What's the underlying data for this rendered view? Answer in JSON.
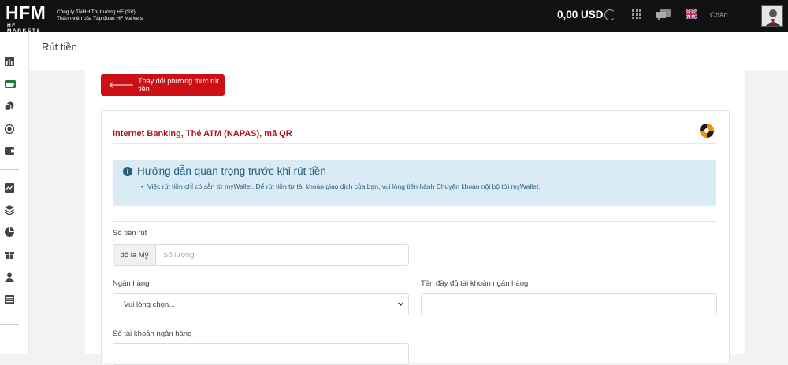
{
  "brand": {
    "logo_text": "HFM",
    "logo_subtext": "HF MARKETS",
    "company_line1": "Công ty TNHH Thị trường HF (SV)",
    "company_line2": "Thành viên của Tập đoàn HF Markets"
  },
  "header": {
    "balance": "0,00 USD",
    "greeting": "Chào"
  },
  "page": {
    "title": "Rút tiền"
  },
  "actions": {
    "change_method_label": "Thay đổi phương thức rút tiền"
  },
  "card": {
    "title": "Internet Banking, Thẻ ATM (NAPAS), mã QR",
    "info_title": "Hướng dẫn quan trọng trước khi rút tiền",
    "info_text": "Việc rút tiền chỉ có sẵn từ myWallet. Để rút tiền từ tài khoản giao dịch của bạn, vui lòng tiến hành Chuyển khoản nội bộ tới myWallet."
  },
  "form": {
    "amount_label": "Số tiền rút",
    "currency_addon": "đô la Mỹ",
    "amount_placeholder": "Số lượng",
    "bank_label": "Ngân hàng",
    "bank_selected": "Vui lòng chọn...",
    "account_name_label": "Tên đầy đủ tài khoản ngân hàng",
    "account_number_label": "Số tài khoản ngân hàng"
  },
  "colors": {
    "accent_red": "#cc1016",
    "title_red": "#b5121b",
    "info_bg": "#d9ecf5",
    "info_text": "#2a5c7e",
    "topbar": "#111111"
  },
  "sidebar": {
    "icons": [
      "chart-bar-icon",
      "wallet-money-icon",
      "coins-icon",
      "transfer-icon",
      "wallet-icon",
      "line-chart-icon",
      "layers-icon",
      "pie-chart-icon",
      "gift-icon",
      "user-icon",
      "list-icon"
    ]
  }
}
